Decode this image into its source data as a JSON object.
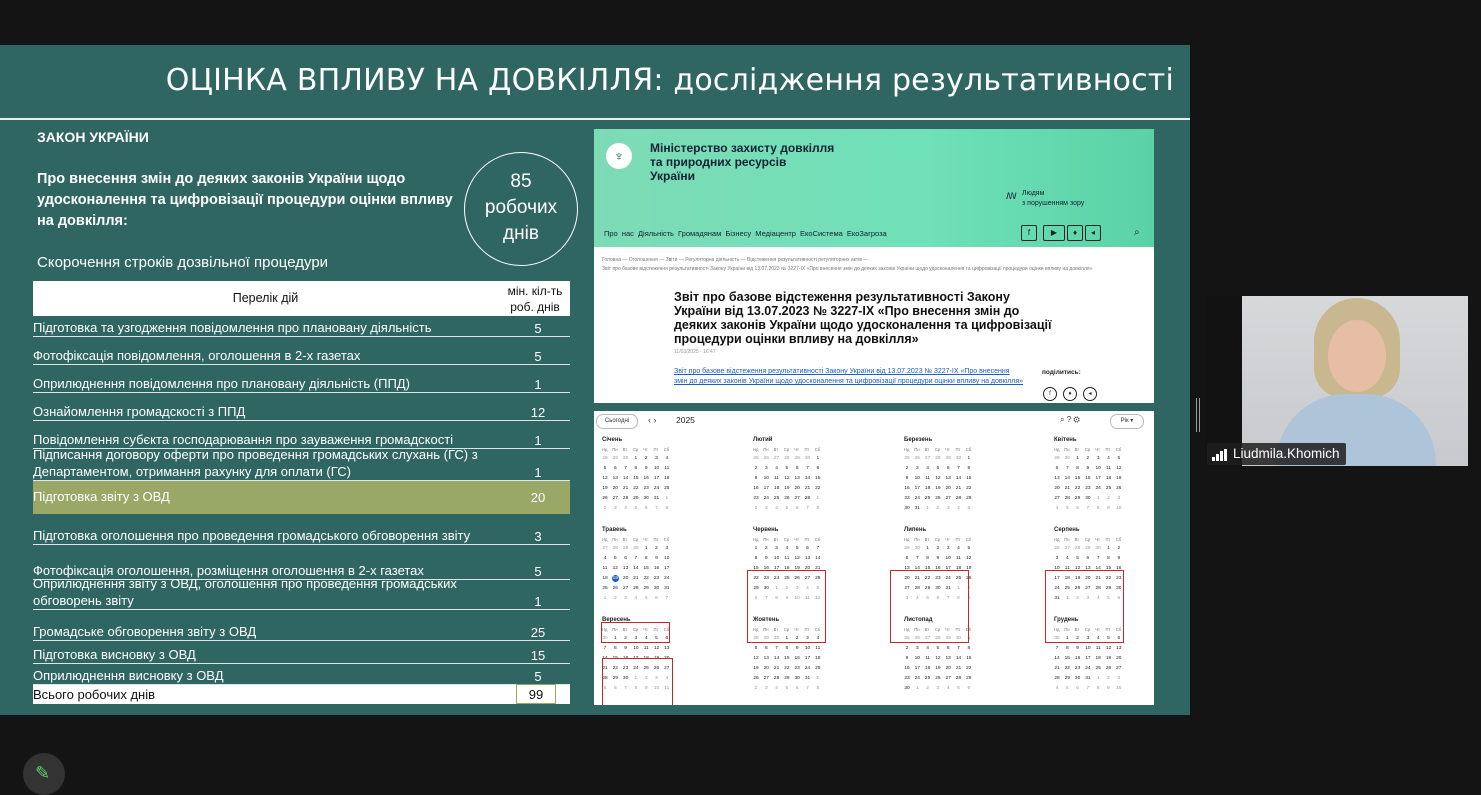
{
  "slide": {
    "title": "ОЦІНКА ВПЛИВУ НА ДОВКІЛЛЯ: дослідження результативності",
    "law_heading": "ЗАКОН УКРАЇНИ",
    "law_title": "Про внесення змін до деяких законів України щодо удосконалення та цифровізації процедури оцінки впливу на довкілля:",
    "circle": {
      "number": "85",
      "line2": "робочих",
      "line3": "днів"
    },
    "subtitle": "Скорочення строків дозвільної процедури",
    "table": {
      "col1": "Перелік дій",
      "col2_line1": "мін. кіл-ть",
      "col2_line2": "роб. днів",
      "rows": [
        {
          "name": "Підготовка та узгодження повідомлення про плановану діяльність",
          "value": "5"
        },
        {
          "name": "Фотофіксація повідомлення, оголошення в 2-х газетах",
          "value": "5"
        },
        {
          "name": "Оприлюднення повідомлення про плановану діяльність (ППД)",
          "value": "1"
        },
        {
          "name": "Ознайомлення громадскості з ППД",
          "value": "12"
        },
        {
          "name": "Повідомлення субєкта господарювання про зауваження громадскості",
          "value": "1"
        },
        {
          "name": "Підписання договору оферти про проведення громадських слухань (ГС) з Департаментом, отримання рахунку для оплати (ГС)",
          "value": "1"
        },
        {
          "name": "Підготовка звіту з ОВД",
          "value": "20"
        },
        {
          "name": "Підготовка оголошення про проведення громадського обговорення звіту",
          "value": "3"
        },
        {
          "name": "Фотофіксація оголошення, розміщення оголошення в 2-х газетах",
          "value": "5"
        },
        {
          "name": "Оприлюднення звіту з ОВД, оголошення про проведення громадських обговорень звіту",
          "value": "1"
        },
        {
          "name": "Громадське обговорення звіту з ОВД",
          "value": "25"
        },
        {
          "name": "Підготовка  висновку з ОВД",
          "value": "15"
        },
        {
          "name": "Оприлюднення висновку з ОВД",
          "value": "5"
        }
      ],
      "total_label": "Всього робочих днів",
      "total_value": "99"
    }
  },
  "site": {
    "logo_glyph": "♆",
    "ministry_line1": "Міністерство захисту довкілля",
    "ministry_line2": "та природних ресурсів",
    "ministry_line3": "України",
    "slogan_glyph": "ꟿ",
    "slogan_line1": "Людям",
    "slogan_line2": "з порушенням зору",
    "nav": "Про нас  Діяльність  Громадянам  Бізнесу  Медіацентр  ЕкоСистема  ЕкоЗагроза",
    "social": [
      "f",
      "▶",
      "♦",
      "◂"
    ],
    "search_icon": "⌕",
    "breadcrumb1": "Головна  —  Оголошення  —  Звіти  —  Регуляторна діяльність  —  Відстеження результативності регуляторних актів  —",
    "breadcrumb2": "Звіт про базове відстеження результативності Закону України від 13.07.2023 № 3227-IX «Про внесення змін до деяких законів України щодо удосконалення та цифровізації процедури оцінки впливу на довкілля»",
    "headline": "Звіт про базове відстеження результативності Закону України від 13.07.2023 № 3227-IX «Про внесення змін до деяких законів України щодо удосконалення та цифровізації процедури оцінки впливу на довкілля»",
    "date": "11/03/2025 - 16:47",
    "link": "Звіт про базове відстеження результативності Закону України від 13.07.2023 № 3227-IX «Про внесення змін до деяких законів України щодо удосконалення та цифровізації процедури оцінки впливу на довкілля»",
    "share": "поділитись:",
    "share_icons": [
      "f",
      "♦",
      "◂"
    ]
  },
  "calendar": {
    "today_btn": "Сьогодні",
    "nav": "‹   ›",
    "year": "2025",
    "tools": "⌕  ?  ⚙",
    "year_btn": "Рік ▾",
    "weekdays": [
      "Нд",
      "Пн",
      "Вт",
      "Ср",
      "Чт",
      "Пт",
      "Сб"
    ],
    "months": [
      {
        "name": "Січень",
        "start": 3,
        "len": 31
      },
      {
        "name": "Лютий",
        "start": 6,
        "len": 28
      },
      {
        "name": "Березень",
        "start": 6,
        "len": 31
      },
      {
        "name": "Квітень",
        "start": 2,
        "len": 30
      },
      {
        "name": "Травень",
        "start": 4,
        "len": 31
      },
      {
        "name": "Червень",
        "start": 0,
        "len": 30
      },
      {
        "name": "Липень",
        "start": 2,
        "len": 31
      },
      {
        "name": "Серпень",
        "start": 5,
        "len": 31
      },
      {
        "name": "Вересень",
        "start": 1,
        "len": 30
      },
      {
        "name": "Жовтень",
        "start": 3,
        "len": 31
      },
      {
        "name": "Листопад",
        "start": 6,
        "len": 30
      },
      {
        "name": "Грудень",
        "start": 1,
        "len": 31
      }
    ],
    "today_day": "19",
    "today_month": "Травень"
  },
  "participant": {
    "name": "Liudmila.Khomich"
  },
  "colors": {
    "slide_bg": "#2f6662",
    "highlight": "#9aa867",
    "mark": "#c8242c"
  }
}
